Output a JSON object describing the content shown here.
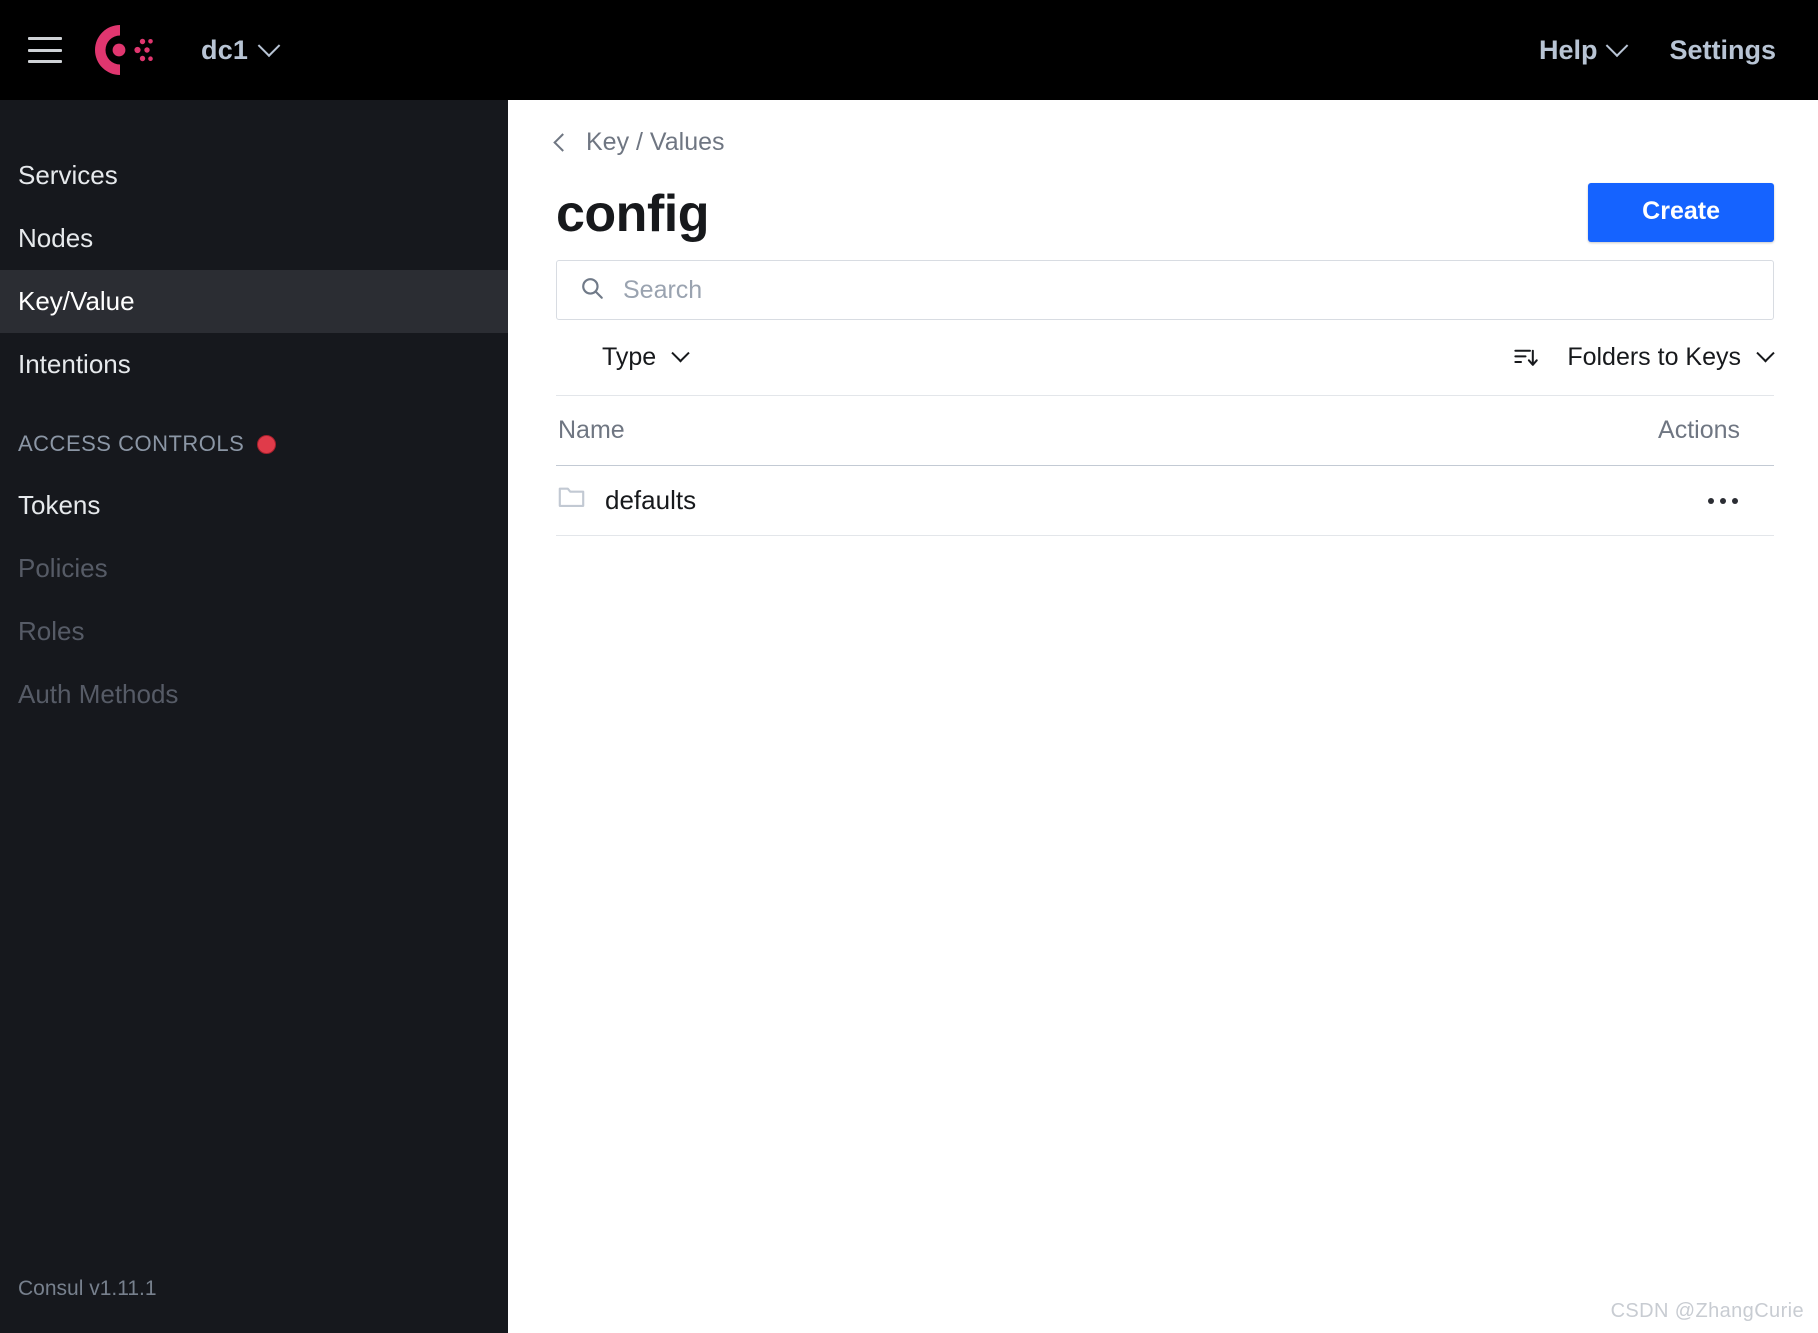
{
  "topnav": {
    "menu_icon": "hamburger-menu-icon",
    "logo_icon": "consul-logo-icon",
    "datacenter": {
      "label": "dc1",
      "chevron_icon": "chevron-down-icon"
    },
    "help": {
      "label": "Help",
      "chevron_icon": "chevron-down-icon"
    },
    "settings": {
      "label": "Settings"
    },
    "background_color": "#000000",
    "text_color": "#b8c4d4",
    "logo_color": "#e0366f"
  },
  "sidebar": {
    "background_color": "#16181d",
    "active_background_color": "#2b2d33",
    "items": [
      {
        "label": "Services",
        "state": "default"
      },
      {
        "label": "Nodes",
        "state": "default"
      },
      {
        "label": "Key/Value",
        "state": "active"
      },
      {
        "label": "Intentions",
        "state": "default"
      }
    ],
    "group": {
      "title": "ACCESS CONTROLS",
      "badge_icon": "red-dot-badge",
      "badge_color": "#e03b4a",
      "items": [
        {
          "label": "Tokens",
          "state": "default"
        },
        {
          "label": "Policies",
          "state": "disabled"
        },
        {
          "label": "Roles",
          "state": "disabled"
        },
        {
          "label": "Auth Methods",
          "state": "disabled"
        }
      ]
    },
    "footer": "Consul v1.11.1"
  },
  "main": {
    "breadcrumb": {
      "back_icon": "chevron-left-icon",
      "label": "Key / Values"
    },
    "page_title": "config",
    "create_button": {
      "label": "Create",
      "color": "#1563ff"
    },
    "search": {
      "icon": "search-icon",
      "value": "",
      "placeholder": "Search"
    },
    "filters": {
      "type_dropdown": {
        "label": "Type",
        "chevron_icon": "chevron-down-icon"
      },
      "sort_icon": "sort-descending-icon",
      "sort_dropdown": {
        "label": "Folders to Keys",
        "chevron_icon": "chevron-down-icon"
      }
    },
    "table": {
      "columns": [
        "Name",
        "Actions"
      ],
      "rows": [
        {
          "icon": "folder-icon",
          "name": "defaults",
          "actions_icon": "more-horizontal-icon"
        }
      ]
    }
  },
  "watermark": "CSDN @ZhangCurie"
}
